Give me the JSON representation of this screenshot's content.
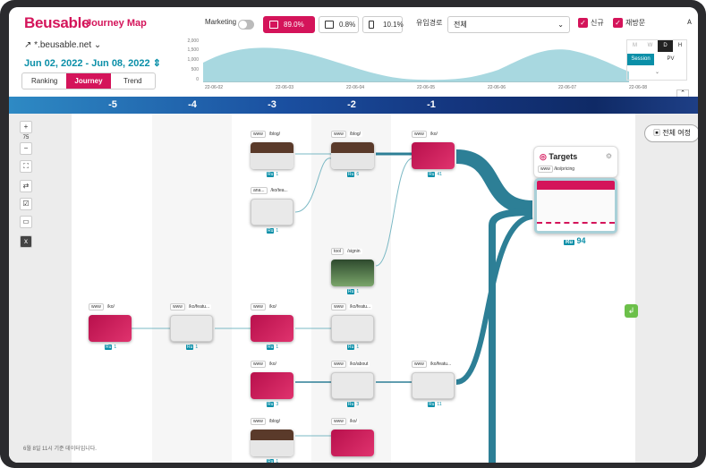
{
  "app": {
    "logo": "Beusable",
    "title": "Journey Map"
  },
  "site": {
    "domain": "*.beusable.net"
  },
  "date_range": "Jun 02, 2022 - Jun 08, 2022",
  "tabs": [
    {
      "label": "Ranking"
    },
    {
      "label": "Journey",
      "active": true
    },
    {
      "label": "Trend"
    }
  ],
  "filters": {
    "marketing_label": "Marketing",
    "devices": [
      {
        "value": "89.0%",
        "active": true
      },
      {
        "value": "0.8%"
      },
      {
        "value": "10.1%"
      }
    ],
    "inflow_label": "유입경로",
    "inflow_value": "전체",
    "new_label": "신규",
    "returning_label": "재방문"
  },
  "chart": {
    "y_ticks": [
      "2,000",
      "1,500",
      "1,000",
      "500",
      "0"
    ],
    "x_ticks": [
      "22-06-02",
      "22-06-03",
      "22-06-04",
      "22-06-05",
      "22-06-06",
      "22-06-07",
      "22-06-08"
    ],
    "granularity": [
      "M",
      "W",
      "D",
      "H"
    ],
    "granularity_selected": "D",
    "modes": [
      "Session",
      "PV"
    ],
    "mode_selected": "Session",
    "fill_color": "#a8d8e0"
  },
  "columns": [
    "-5",
    "-4",
    "-3",
    "-2",
    "-1"
  ],
  "nodes": {
    "c3_blog": {
      "tag": "www",
      "path": "/blog/",
      "count": "1"
    },
    "c3_kotea": {
      "tag": "ana...",
      "path": "/ko/tea...",
      "count": "1"
    },
    "c3_ko": {
      "tag": "www",
      "path": "/ko/",
      "count": "1"
    },
    "c3_ko2": {
      "tag": "www",
      "path": "/ko/",
      "count": "3"
    },
    "c3_blog2": {
      "tag": "www",
      "path": "/blog/",
      "count": "1"
    },
    "c2_blog": {
      "tag": "www",
      "path": "/blog/",
      "count": "6"
    },
    "c2_signin": {
      "tag": "tool",
      "path": "/signin",
      "count": "1"
    },
    "c2_kofeatu": {
      "tag": "www",
      "path": "/ko/featu...",
      "count": "1"
    },
    "c2_koabout": {
      "tag": "www",
      "path": "/ko/about",
      "count": "3"
    },
    "c2_ko": {
      "tag": "www",
      "path": "/ko/",
      "count": ""
    },
    "c1_ko": {
      "tag": "www",
      "path": "/ko/",
      "count": "41"
    },
    "c1_kofeatu": {
      "tag": "www",
      "path": "/ko/featu...",
      "count": "11"
    },
    "c5_ko": {
      "tag": "www",
      "path": "/ko/",
      "count": "1"
    },
    "c4_kofeatu": {
      "tag": "www",
      "path": "/ko/featu...",
      "count": "1"
    }
  },
  "target": {
    "title": "Targets",
    "tag": "www",
    "path": "/ko/pricing",
    "count": "94"
  },
  "full_journey_label": "전체 여정",
  "zoom": "75",
  "footer": "6월 8일 11시 기준 데이터입니다."
}
